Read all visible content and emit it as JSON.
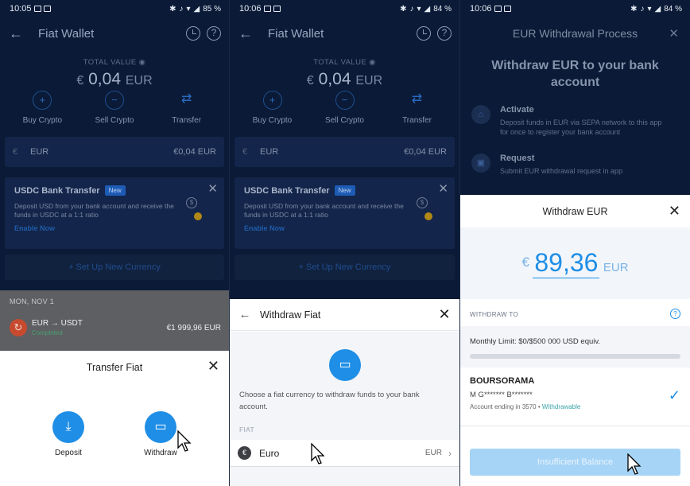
{
  "panels": [
    {
      "status": {
        "time": "10:05",
        "battery": "85 %"
      },
      "header": {
        "title": "Fiat Wallet"
      },
      "total": {
        "label": "TOTAL VALUE",
        "symbol": "€",
        "amount": "0,04",
        "currency": "EUR"
      },
      "actions": [
        {
          "label": "Buy Crypto",
          "icon": "plus-icon"
        },
        {
          "label": "Sell Crypto",
          "icon": "minus-icon"
        },
        {
          "label": "Transfer",
          "icon": "transfer-icon"
        }
      ],
      "currency_row": {
        "symbol": "€",
        "name": "EUR",
        "value": "€0,04 EUR"
      },
      "usdc": {
        "title": "USDC Bank Transfer",
        "badge": "New",
        "desc": "Deposit USD from your bank account and receive the funds in USDC at a 1:1 ratio",
        "link": "Enable Now"
      },
      "setup": "+ Set Up New Currency",
      "history": {
        "date": "MON, NOV 1",
        "tx_title": "EUR → USDT",
        "tx_status": "Completed",
        "tx_amount": "€1 999,96 EUR"
      },
      "sheet": {
        "title": "Transfer Fiat",
        "options": [
          {
            "label": "Deposit",
            "icon": "download-icon"
          },
          {
            "label": "Withdraw",
            "icon": "bank-icon"
          }
        ]
      }
    },
    {
      "status": {
        "time": "10:06",
        "battery": "84 %"
      },
      "header": {
        "title": "Fiat Wallet"
      },
      "sheet": {
        "title": "Withdraw Fiat",
        "desc": "Choose a fiat currency to withdraw funds to your bank account.",
        "section": "FIAT",
        "row": {
          "name": "Euro",
          "code": "EUR"
        }
      }
    },
    {
      "status": {
        "time": "10:06",
        "battery": "84 %"
      },
      "header": {
        "title": "EUR Withdrawal Process"
      },
      "headline": "Withdraw EUR to your bank account",
      "steps": [
        {
          "title": "Activate",
          "desc": "Deposit funds in EUR via SEPA network to this app for once to register your bank account"
        },
        {
          "title": "Request",
          "desc": "Submit EUR withdrawal request in app"
        }
      ],
      "sheet": {
        "title": "Withdraw EUR",
        "symbol": "€",
        "amount": "89,36",
        "currency": "EUR",
        "withdraw_to": "WITHDRAW TO",
        "limit": "Monthly Limit:  $0/$500 000 USD equiv.",
        "bank_name": "BOURSORAMA",
        "holder": "M  G******* B*******",
        "account": "Account ending in 3570",
        "withdrawable": "Withdrawable",
        "button": "Insufficient Balance"
      }
    }
  ],
  "colors": {
    "primary": "#1f8ee6",
    "bg": "#0b1a36"
  }
}
